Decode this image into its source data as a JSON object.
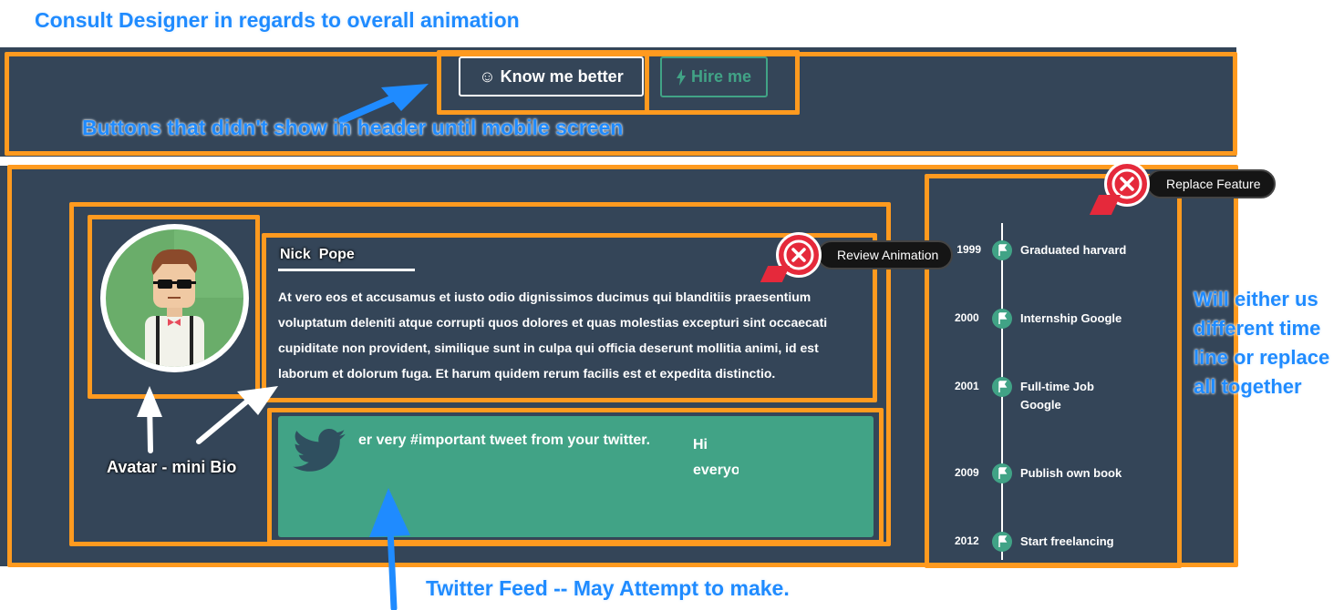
{
  "annotations": {
    "title": "Consult Designer in regards to overall animation",
    "buttons_note": "Buttons that didn't show in header until mobile screen",
    "timeline_note": "Will either us different time line or replace all together",
    "twitter_note": "Twitter Feed -- May Attempt to make.",
    "avatar_note": "Avatar - mini Bio"
  },
  "header": {
    "know_button": {
      "icon": "smiley-icon",
      "label": "☺ Know me better"
    },
    "hire_button": {
      "icon": "lightning-icon",
      "label": "Hire me"
    }
  },
  "bio": {
    "name": "Nick  Pope",
    "text": "At vero eos et accusamus et iusto odio dignissimos ducimus qui blanditiis praesentium voluptatum deleniti atque corrupti quos dolores et quas molestias excepturi sint occaecati cupiditate non provident, similique sunt in culpa qui officia deserunt mollitia animi, id est laborum et dolorum fuga. Et harum quidem rerum facilis est et expedita distinctio."
  },
  "twitter": {
    "icon": "twitter-bird-icon",
    "tweet_1": "er very #important tweet from your twitter.",
    "tweet_2": "Hi everyone web te"
  },
  "badges": {
    "review": "Review Animation",
    "replace": "Replace Feature"
  },
  "timeline": [
    {
      "year": "1999",
      "label": "Graduated harvard"
    },
    {
      "year": "2000",
      "label": "Internship Google"
    },
    {
      "year": "2001",
      "label": "Full-time Job Google"
    },
    {
      "year": "2009",
      "label": "Publish own book"
    },
    {
      "year": "2012",
      "label": "Start freelancing"
    }
  ],
  "colors": {
    "panel": "#344558",
    "accent_green": "#41a386",
    "annotation_orange": "#ff9a1f",
    "annotation_blue": "#1f8bff",
    "badge_red": "#e5293b"
  }
}
